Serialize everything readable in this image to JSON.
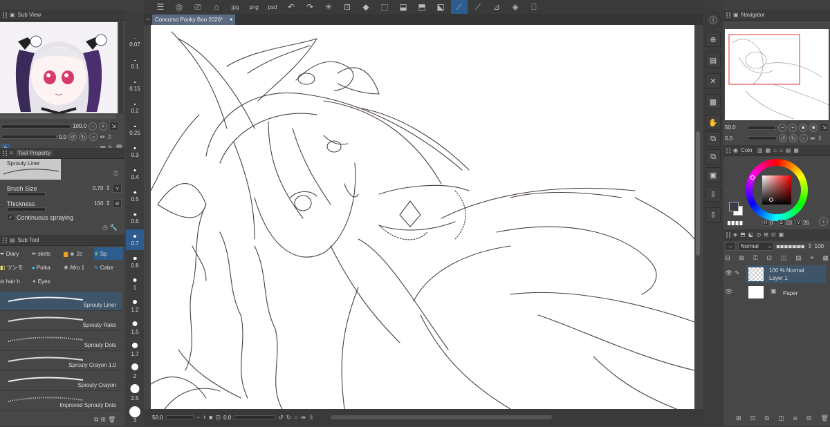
{
  "subview": {
    "title": "Sub View",
    "zoom_value": "100.0",
    "rotate_value": "0.0"
  },
  "tool_property": {
    "title": "Tool Property",
    "tool_name": "Sprouty Liner",
    "brush_size_label": "Brush Size",
    "brush_size_value": "0.70",
    "thickness_label": "Thickness",
    "thickness_value": "150",
    "continuous_label": "Continuous spraying"
  },
  "subtool": {
    "title": "Sub Tool",
    "groups": [
      "Diary",
      "sketc",
      "2c",
      "Sp",
      "ツンモ",
      "Polka",
      "Afro 1",
      "Cabe",
      "hair h",
      "Eyes"
    ],
    "brushes": [
      "Sprouty Liner",
      "Sprouty Rake",
      "Sprouty Dots",
      "Sprouty Crayon 1.0",
      "Sprouty Crayon",
      "Improved Sprouty Dots"
    ]
  },
  "brush_sizes": [
    "0.07",
    "0.1",
    "0.15",
    "0.2",
    "0.25",
    "0.3",
    "0.4",
    "0.5",
    "0.6",
    "0.7",
    "0.8",
    "1",
    "1.2",
    "1.5",
    "1.7",
    "2",
    "2.5",
    "3"
  ],
  "canvas": {
    "tab_title": "Concurso Pooky Boo 2026*",
    "zoom": "50.0",
    "angle": "0.0"
  },
  "navigator": {
    "title": "Navigator",
    "zoom": "50.0",
    "angle": "0.0"
  },
  "color": {
    "title": "Colo",
    "values": [
      "H",
      "0",
      "S",
      "23",
      "V",
      "26"
    ]
  },
  "layers": {
    "blend_mode": "Normal",
    "opacity": "100",
    "items": [
      {
        "line1": "100 % Normal",
        "line2": "Layer 1"
      },
      {
        "line1": "Paper",
        "line2": ""
      }
    ]
  },
  "colors": {
    "accent": "#2d5d8f",
    "panel": "#474747"
  }
}
